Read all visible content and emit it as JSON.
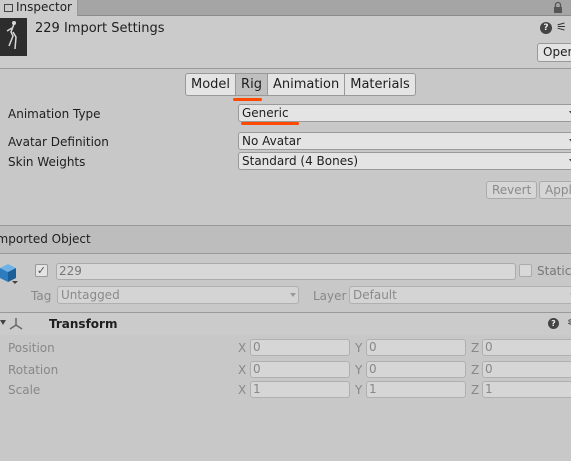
{
  "window_tab": {
    "title": "Inspector"
  },
  "header": {
    "title": "229 Import Settings",
    "open_button": "Open"
  },
  "tabs": [
    "Model",
    "Rig",
    "Animation",
    "Materials"
  ],
  "active_tab": "Rig",
  "rig": {
    "animation_type_label": "Animation Type",
    "animation_type_value": "Generic",
    "avatar_definition_label": "Avatar Definition",
    "avatar_definition_value": "No Avatar",
    "skin_weights_label": "Skin Weights",
    "skin_weights_value": "Standard (4 Bones)",
    "revert_button": "Revert",
    "apply_button": "Apply"
  },
  "imported_object": {
    "section_title": "Imported Object",
    "name": "229",
    "static_label": "Static",
    "tag_label": "Tag",
    "tag_value": "Untagged",
    "layer_label": "Layer",
    "layer_value": "Default"
  },
  "transform": {
    "title": "Transform",
    "rows": [
      {
        "label": "Position",
        "x": "0",
        "y": "0",
        "z": "0"
      },
      {
        "label": "Rotation",
        "x": "0",
        "y": "0",
        "z": "0"
      },
      {
        "label": "Scale",
        "x": "1",
        "y": "1",
        "z": "1"
      }
    ],
    "axis_x": "X",
    "axis_y": "Y",
    "axis_z": "Z"
  },
  "colors": {
    "annotation": "#ff4800",
    "background": "#c8c8c8"
  }
}
